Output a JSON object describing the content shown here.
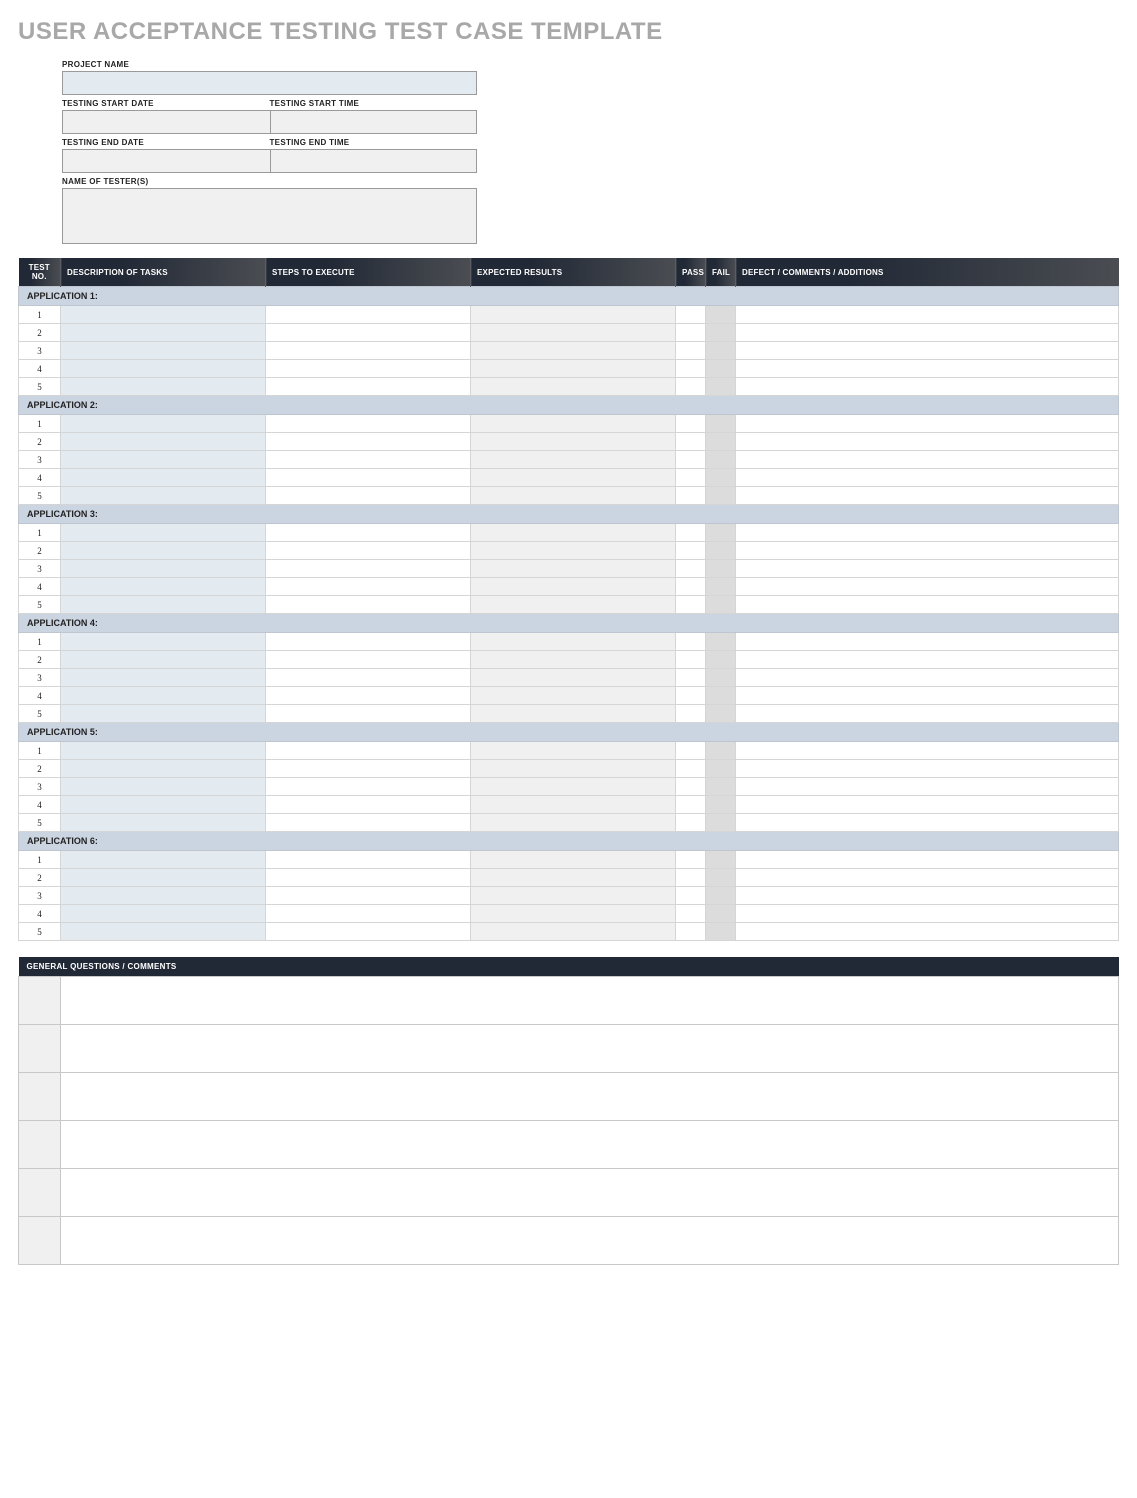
{
  "title": "USER ACCEPTANCE TESTING TEST CASE TEMPLATE",
  "meta": {
    "projectName": {
      "label": "PROJECT NAME",
      "value": ""
    },
    "startDate": {
      "label": "TESTING START DATE",
      "value": ""
    },
    "startTime": {
      "label": "TESTING START TIME",
      "value": ""
    },
    "endDate": {
      "label": "TESTING END DATE",
      "value": ""
    },
    "endTime": {
      "label": "TESTING END TIME",
      "value": ""
    },
    "testers": {
      "label": "NAME OF TESTER(S)",
      "value": ""
    }
  },
  "columns": {
    "testNo": "TEST NO.",
    "desc": "DESCRIPTION OF TASKS",
    "steps": "STEPS TO EXECUTE",
    "expected": "EXPECTED RESULTS",
    "pass": "PASS",
    "fail": "FAIL",
    "defect": "DEFECT / COMMENTS / ADDITIONS"
  },
  "applications": [
    {
      "name": "APPLICATION 1:",
      "rows": [
        "1",
        "2",
        "3",
        "4",
        "5"
      ]
    },
    {
      "name": "APPLICATION 2:",
      "rows": [
        "1",
        "2",
        "3",
        "4",
        "5"
      ]
    },
    {
      "name": "APPLICATION 3:",
      "rows": [
        "1",
        "2",
        "3",
        "4",
        "5"
      ]
    },
    {
      "name": "APPLICATION 4:",
      "rows": [
        "1",
        "2",
        "3",
        "4",
        "5"
      ]
    },
    {
      "name": "APPLICATION 5:",
      "rows": [
        "1",
        "2",
        "3",
        "4",
        "5"
      ]
    },
    {
      "name": "APPLICATION 6:",
      "rows": [
        "1",
        "2",
        "3",
        "4",
        "5"
      ]
    }
  ],
  "generalQuestions": {
    "header": "GENERAL QUESTIONS / COMMENTS",
    "rowCount": 6
  }
}
